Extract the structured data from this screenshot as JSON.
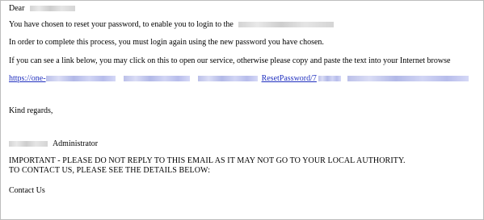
{
  "email": {
    "greeting": "Dear",
    "line_reset": "You have chosen to reset your password, to enable you to login to the",
    "line_process": "In order to complete this process, you must login again using the new password you have chosen.",
    "line_link_instructions": "If you can see a link below, you may click on this to open our service, otherwise please copy and paste the text into your Internet browse",
    "reset_link": {
      "prefix": "https://one-",
      "middle": "ResetPassword/7"
    },
    "closing": "Kind regards,",
    "signature_role": "Administrator",
    "important_line1": "IMPORTANT - PLEASE DO NOT REPLY TO THIS EMAIL AS IT MAY NOT GO TO YOUR LOCAL AUTHORITY.",
    "important_line2": "TO CONTACT US, PLEASE SEE THE DETAILS BELOW:",
    "contact_heading": "Contact Us"
  },
  "colors": {
    "link": "#1f2fbf",
    "text": "#000000",
    "border": "#bdbdbd",
    "background": "#ffffff"
  }
}
